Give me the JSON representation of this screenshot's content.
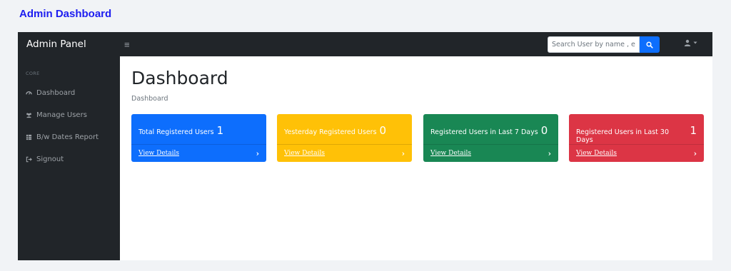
{
  "page_heading": "Admin Dashboard",
  "topbar": {
    "brand": "Admin Panel",
    "toggle_icon": "menu-icon",
    "search_placeholder": "Search User by name , em"
  },
  "sidebar": {
    "heading": "CORE",
    "items": [
      {
        "label": "Dashboard",
        "icon": "tachometer-icon"
      },
      {
        "label": "Manage Users",
        "icon": "users-icon"
      },
      {
        "label": "B/w Dates Report",
        "icon": "table-icon"
      },
      {
        "label": "Signout",
        "icon": "signout-icon"
      }
    ]
  },
  "main": {
    "title": "Dashboard",
    "breadcrumb": "Dashboard",
    "cards": [
      {
        "label": "Total Registered Users",
        "value": "1",
        "link": "View Details",
        "color": "#0d6efd"
      },
      {
        "label": "Yesterday Registered Users",
        "value": "0",
        "link": "View Details",
        "color": "#ffc107"
      },
      {
        "label": "Registered Users in Last 7 Days",
        "value": "0",
        "link": "View Details",
        "color": "#198754"
      },
      {
        "label": "Registered Users in Last 30 Days",
        "value": "1",
        "link": "View Details",
        "color": "#dc3545"
      }
    ]
  }
}
